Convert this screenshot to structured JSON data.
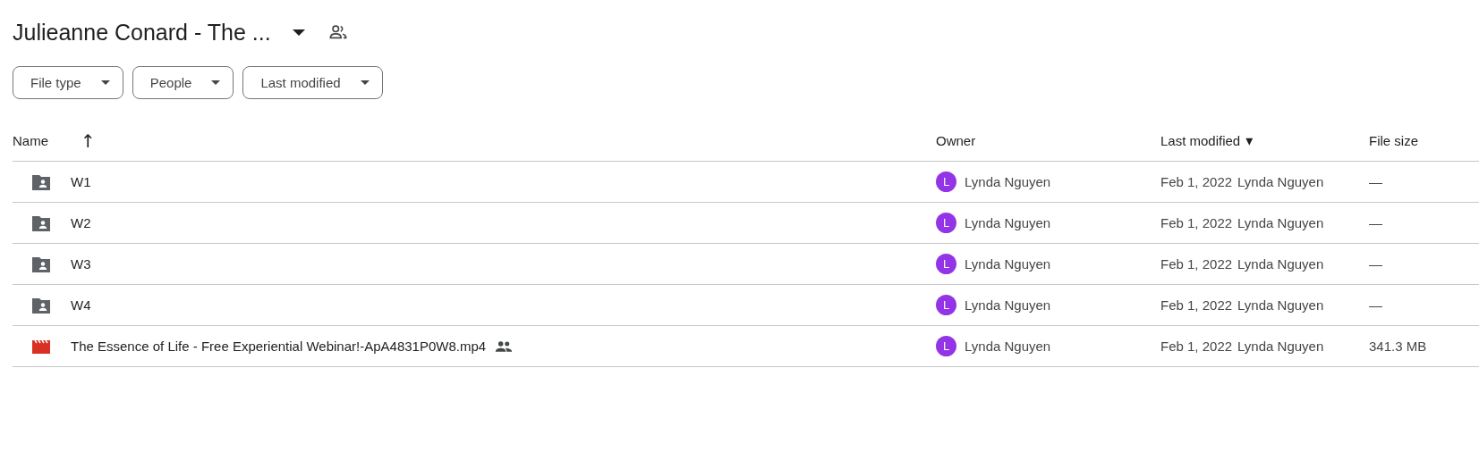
{
  "header": {
    "title": "Julieanne Conard - The ..."
  },
  "filters": [
    {
      "label": "File type"
    },
    {
      "label": "People"
    },
    {
      "label": "Last modified"
    }
  ],
  "table": {
    "columns": [
      {
        "label": "Name",
        "sort_mark": "↑"
      },
      {
        "label": "Owner"
      },
      {
        "label": "Last modified",
        "sort_mark": "▾"
      },
      {
        "label": "File size"
      }
    ],
    "rows": [
      {
        "kind": "folder",
        "name": "W1",
        "shared": false,
        "owner": {
          "initial": "L",
          "name": "Lynda Nguyen",
          "color": "#9334e6"
        },
        "modified": "Feb 1, 2022",
        "modified_by": "Lynda Nguyen",
        "size": "—"
      },
      {
        "kind": "folder",
        "name": "W2",
        "shared": false,
        "owner": {
          "initial": "L",
          "name": "Lynda Nguyen",
          "color": "#9334e6"
        },
        "modified": "Feb 1, 2022",
        "modified_by": "Lynda Nguyen",
        "size": "—"
      },
      {
        "kind": "folder",
        "name": "W3",
        "shared": false,
        "owner": {
          "initial": "L",
          "name": "Lynda Nguyen",
          "color": "#9334e6"
        },
        "modified": "Feb 1, 2022",
        "modified_by": "Lynda Nguyen",
        "size": "—"
      },
      {
        "kind": "folder",
        "name": "W4",
        "shared": false,
        "owner": {
          "initial": "L",
          "name": "Lynda Nguyen",
          "color": "#9334e6"
        },
        "modified": "Feb 1, 2022",
        "modified_by": "Lynda Nguyen",
        "size": "—"
      },
      {
        "kind": "video",
        "name": "The Essence of Life - Free Experiential Webinar!-ApA4831P0W8.mp4",
        "shared": true,
        "owner": {
          "initial": "L",
          "name": "Lynda Nguyen",
          "color": "#9334e6"
        },
        "modified": "Feb 1, 2022",
        "modified_by": "Lynda Nguyen",
        "size": "341.3 MB"
      }
    ]
  }
}
